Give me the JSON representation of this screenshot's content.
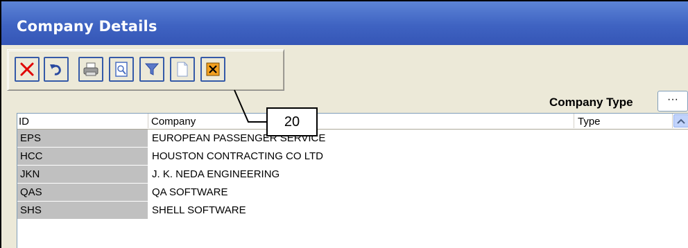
{
  "window": {
    "title": "Company Details"
  },
  "toolbar": {
    "buttons": [
      {
        "name": "delete-button",
        "icon": "delete-icon"
      },
      {
        "name": "undo-button",
        "icon": "undo-icon"
      },
      {
        "name": "print-button",
        "icon": "printer-icon"
      },
      {
        "name": "preview-button",
        "icon": "print-preview-icon"
      },
      {
        "name": "filter-button",
        "icon": "filter-icon"
      },
      {
        "name": "new-button",
        "icon": "new-document-icon"
      },
      {
        "name": "close-button",
        "icon": "close-icon"
      }
    ]
  },
  "filter": {
    "label": "Company Type",
    "lookup_label": "···"
  },
  "grid": {
    "columns": [
      "ID",
      "Company",
      "Type"
    ],
    "rows": [
      {
        "id": "EPS",
        "company": "EUROPEAN PASSENGER SERVICE",
        "type": ""
      },
      {
        "id": "HCC",
        "company": "HOUSTON CONTRACTING CO LTD",
        "type": ""
      },
      {
        "id": "JKN",
        "company": "J. K. NEDA ENGINEERING",
        "type": ""
      },
      {
        "id": "QAS",
        "company": "QA SOFTWARE",
        "type": ""
      },
      {
        "id": "SHS",
        "company": "SHELL SOFTWARE",
        "type": ""
      }
    ]
  },
  "callout": {
    "number": "20"
  },
  "colors": {
    "titlebar": "#3f63c2",
    "button_border": "#355aa8",
    "id_column": "#c0c0c0"
  }
}
